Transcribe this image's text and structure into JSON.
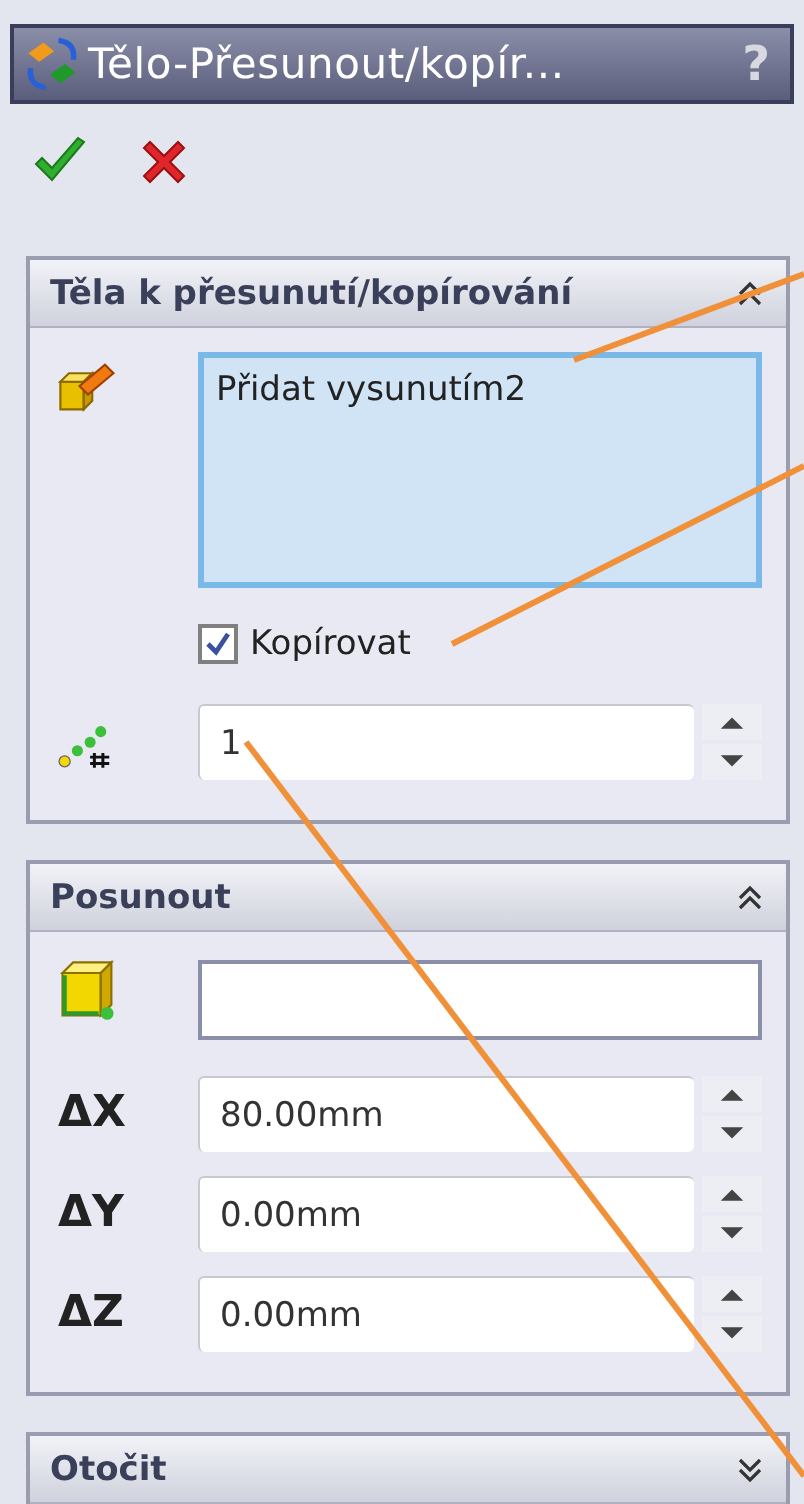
{
  "window": {
    "title": "Tělo-Přesunout/kopír...",
    "help": "?"
  },
  "sections": [
    {
      "title": "Těla k přesunutí/kopírování",
      "expanded": true,
      "rows": [
        {
          "kind": "selection_list",
          "items": [
            "Přidat vysunutím2"
          ],
          "active": true
        },
        {
          "kind": "checkbox",
          "label": "Kopírovat",
          "checked": true
        },
        {
          "kind": "spinner",
          "value": "1"
        }
      ]
    },
    {
      "title": "Posunout",
      "expanded": true,
      "rows": [
        {
          "kind": "selection_box",
          "active": false
        },
        {
          "kind": "spinner",
          "label": "ΔX",
          "value": "80.00mm"
        },
        {
          "kind": "spinner",
          "label": "ΔY",
          "value": "0.00mm"
        },
        {
          "kind": "spinner",
          "label": "ΔZ",
          "value": "0.00mm"
        }
      ]
    },
    {
      "title": "Otočit",
      "expanded": false
    }
  ]
}
